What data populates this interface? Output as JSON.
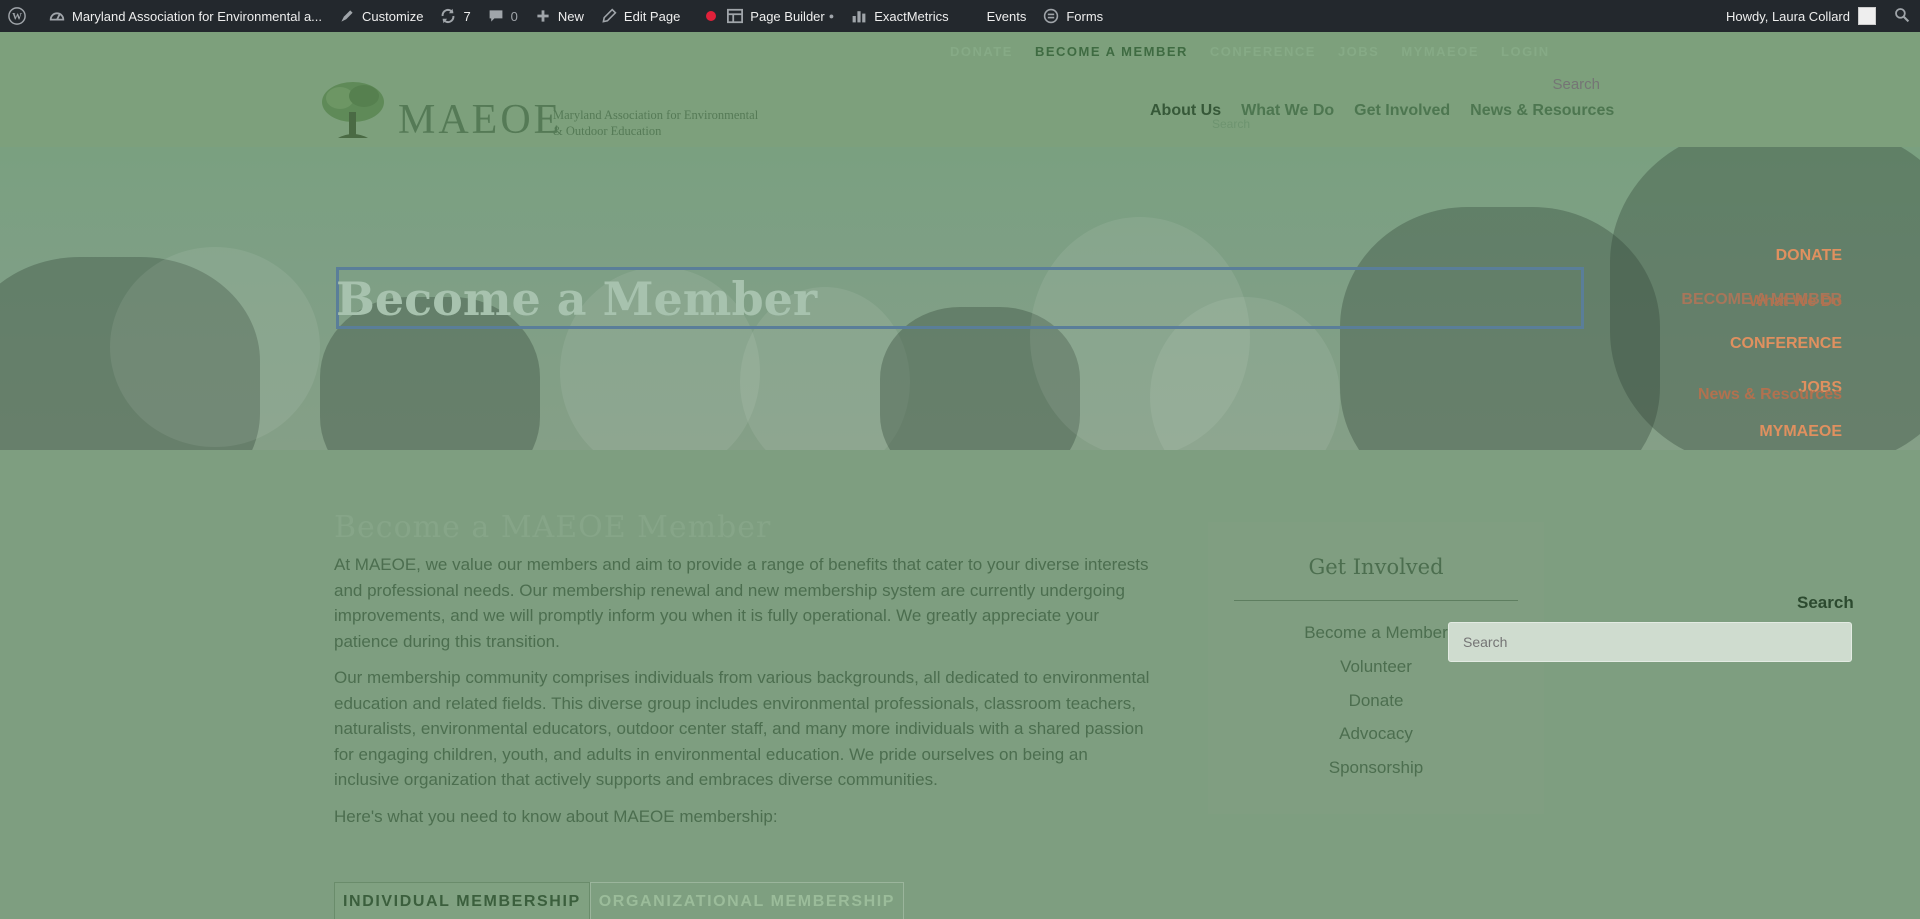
{
  "adminbar": {
    "site_name": "Maryland Association for Environmental a...",
    "customize": "Customize",
    "updates_count": "7",
    "comments_count": "0",
    "new": "New",
    "edit_page": "Edit Page",
    "page_builder": "Page Builder",
    "exactmetrics": "ExactMetrics",
    "events": "Events",
    "forms": "Forms",
    "howdy": "Howdy, Laura Collard"
  },
  "header": {
    "topnav": [
      "Donate",
      "Become a Member",
      "Conference",
      "Jobs",
      "MyMAEOE",
      "Login"
    ],
    "top_search_placeholder": "Search",
    "logo_word": "MAEOE",
    "logo_sub_1": "Maryland Association for Environmental",
    "logo_sub_2": "& Outdoor Education",
    "mainnav": [
      "About Us",
      "What We Do",
      "Get Involved",
      "News & Resources"
    ],
    "ghost_search": "Search"
  },
  "hero": {
    "title": "Become a Member"
  },
  "sidemenu": {
    "items": [
      "DONATE",
      "BECOME A MEMBER",
      "CONFERENCE",
      "JOBS",
      "MYMAEOE"
    ],
    "overlap_what_we_do": "What We Do",
    "overlap_news": "News & Resources"
  },
  "content": {
    "ghost_heading": "Become a MAEOE Member",
    "p1": "At MAEOE, we value our members and aim to provide a range of benefits that cater to your diverse interests and professional needs. Our membership renewal and new membership system are currently undergoing improvements, and we will promptly inform you when it is fully operational. We greatly appreciate your patience during this transition.",
    "p2": "Our membership community comprises individuals from various backgrounds, all dedicated to environmental education and related fields. This diverse group includes environmental professionals, classroom teachers, naturalists, environmental educators, outdoor center staff, and many more individuals with a shared passion for engaging children, youth, and adults in environmental education. We pride ourselves on being an inclusive organization that actively supports and embraces diverse communities.",
    "p3": "Here's what you need to know about MAEOE membership:",
    "tabs": [
      "INDIVIDUAL MEMBERSHIP",
      "ORGANIZATIONAL MEMBERSHIP"
    ]
  },
  "sidebar": {
    "title": "Get Involved",
    "links": [
      "Become a Member",
      "Volunteer",
      "Donate",
      "Advocacy",
      "Sponsorship"
    ]
  },
  "search": {
    "label": "Search",
    "placeholder": "Search"
  }
}
